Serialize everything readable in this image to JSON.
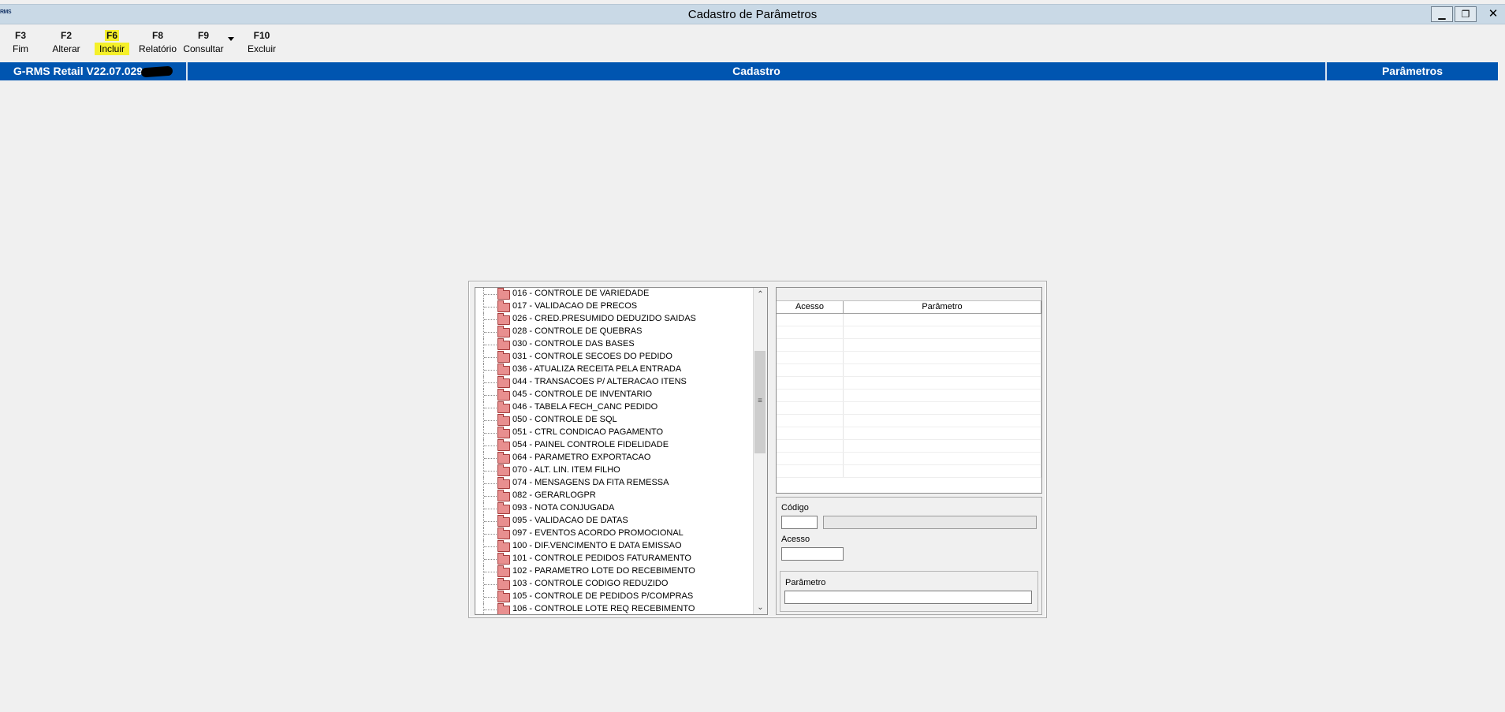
{
  "window": {
    "title": "Cadastro de Parâmetros",
    "app_icon_text": "RMS",
    "minimize_glyph": "▁",
    "restore_glyph": "❐",
    "close_glyph": "✕",
    "extra_glyph": "^"
  },
  "toolbar": {
    "buttons": [
      {
        "key": "F3",
        "label": "Fim"
      },
      {
        "key": "F2",
        "label": "Alterar"
      },
      {
        "key": "F6",
        "label": "Incluir"
      },
      {
        "key": "F8",
        "label": "Relatório"
      },
      {
        "key": "F9",
        "label": "Consultar"
      },
      {
        "key": "F10",
        "label": "Excluir"
      }
    ]
  },
  "header_bar": {
    "version": "G-RMS Retail V22.07.029",
    "section": "Cadastro",
    "module": "Parâmetros",
    "color": "#0055b0"
  },
  "tree": {
    "items": [
      "016 - CONTROLE DE VARIEDADE",
      "017 - VALIDACAO DE PRECOS",
      "026 - CRED.PRESUMIDO DEDUZIDO SAIDAS",
      "028 - CONTROLE DE QUEBRAS",
      "030 - CONTROLE DAS BASES",
      "031 - CONTROLE SECOES DO PEDIDO",
      "036 - ATUALIZA RECEITA PELA ENTRADA",
      "044 - TRANSACOES P/ ALTERACAO ITENS",
      "045 - CONTROLE DE INVENTARIO",
      "046 - TABELA FECH_CANC PEDIDO",
      "050 - CONTROLE DE SQL",
      "051 - CTRL CONDICAO PAGAMENTO",
      "054 - PAINEL CONTROLE FIDELIDADE",
      "064 - PARAMETRO EXPORTACAO",
      "070 - ALT. LIN. ITEM FILHO",
      "074 - MENSAGENS DA FITA REMESSA",
      "082 - GERARLOGPR",
      "093 - NOTA CONJUGADA",
      "095 - VALIDACAO DE DATAS",
      "097 - EVENTOS ACORDO PROMOCIONAL",
      "100 - DIF.VENCIMENTO E DATA EMISSAO",
      "101 - CONTROLE PEDIDOS FATURAMENTO",
      "102 - PARAMETRO LOTE DO RECEBIMENTO",
      "103 - CONTROLE CODIGO REDUZIDO",
      "105 - CONTROLE DE PEDIDOS P/COMPRAS",
      "106 - CONTROLE LOTE REQ RECEBIMENTO"
    ],
    "scroll_up": "⌃",
    "scroll_down": "⌄",
    "scroll_grip": "≡"
  },
  "grid": {
    "columns": [
      "Acesso",
      "Parâmetro"
    ]
  },
  "form": {
    "codigo_label": "Código",
    "codigo_value": "",
    "descricao_value": "",
    "acesso_label": "Acesso",
    "acesso_value": "",
    "parametro_label": "Parâmetro",
    "parametro_value": ""
  }
}
